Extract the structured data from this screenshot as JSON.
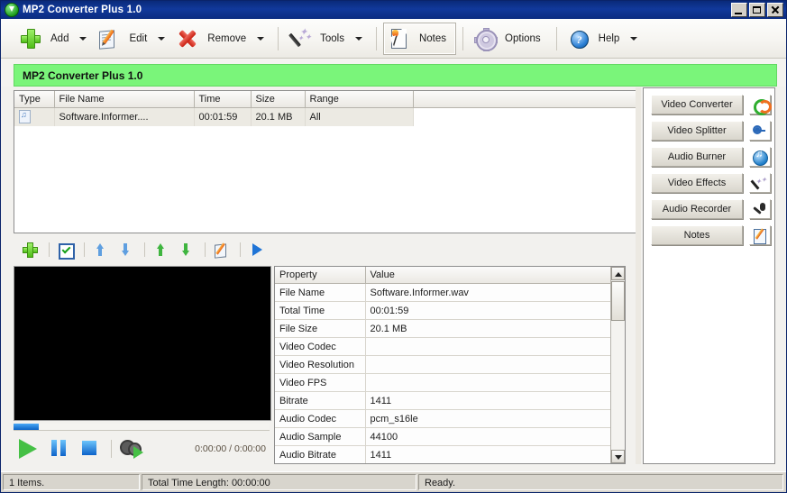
{
  "window": {
    "title": "MP2 Converter Plus 1.0",
    "icon": "download-arrow-icon",
    "controls": {
      "minimize": "Minimize",
      "maximize": "Maximize",
      "close": "Close"
    }
  },
  "toolbar": {
    "items": [
      {
        "label": "Add",
        "icon": "plus-icon",
        "caret": true,
        "pressed": false
      },
      {
        "label": "Edit",
        "icon": "edit-icon",
        "caret": true,
        "pressed": false
      },
      {
        "label": "Remove",
        "icon": "delete-icon",
        "caret": true,
        "pressed": false
      },
      {
        "label": "Tools",
        "icon": "wand-icon",
        "caret": true,
        "pressed": false
      },
      {
        "label": "Notes",
        "icon": "notes-icon",
        "caret": false,
        "pressed": true
      },
      {
        "label": "Options",
        "icon": "gear-icon",
        "caret": false,
        "pressed": false
      },
      {
        "label": "Help",
        "icon": "help-icon",
        "caret": true,
        "pressed": false
      }
    ]
  },
  "banner": {
    "text": "MP2 Converter Plus 1.0",
    "color": "#7af57a"
  },
  "file_list": {
    "columns": [
      "Type",
      "File Name",
      "Time",
      "Size",
      "Range"
    ],
    "rows": [
      {
        "type_icon": "audio-file-icon",
        "file_name": "Software.Informer....",
        "time": "00:01:59",
        "size": "20.1 MB",
        "range": "All"
      }
    ]
  },
  "mini_toolbar": {
    "buttons": [
      {
        "name": "add-file-button",
        "icon": "plus-icon"
      },
      {
        "name": "check-all-button",
        "icon": "checkbox-icon"
      },
      {
        "name": "move-up-button",
        "icon": "arrow-up-blue-icon"
      },
      {
        "name": "move-down-button",
        "icon": "arrow-down-blue-icon"
      },
      {
        "name": "move-top-button",
        "icon": "arrow-up-green-icon"
      },
      {
        "name": "move-bottom-button",
        "icon": "arrow-down-green-icon"
      },
      {
        "name": "edit-item-button",
        "icon": "edit-icon"
      },
      {
        "name": "start-button",
        "icon": "play-blue-icon"
      }
    ]
  },
  "preview": {
    "seek_percent": 10,
    "time_display": "0:00:00 / 0:00:00",
    "controls": [
      {
        "name": "play-button",
        "icon": "play-icon"
      },
      {
        "name": "pause-button",
        "icon": "pause-icon"
      },
      {
        "name": "stop-button",
        "icon": "stop-icon"
      },
      {
        "name": "snapshot-button",
        "icon": "film-play-icon"
      }
    ]
  },
  "properties": {
    "columns": [
      "Property",
      "Value"
    ],
    "rows": [
      {
        "property": "File Name",
        "value": "Software.Informer.wav"
      },
      {
        "property": "Total Time",
        "value": "00:01:59"
      },
      {
        "property": "File Size",
        "value": "20.1 MB"
      },
      {
        "property": "Video Codec",
        "value": ""
      },
      {
        "property": "Video Resolution",
        "value": ""
      },
      {
        "property": "Video FPS",
        "value": ""
      },
      {
        "property": "Bitrate",
        "value": "1411"
      },
      {
        "property": "Audio Codec",
        "value": "pcm_s16le"
      },
      {
        "property": "Audio Sample",
        "value": "44100"
      },
      {
        "property": "Audio Bitrate",
        "value": "1411"
      }
    ]
  },
  "right_panel": {
    "buttons": [
      {
        "label": "Video Converter",
        "icon": "convert-icon"
      },
      {
        "label": "Video Splitter",
        "icon": "scissors-icon"
      },
      {
        "label": "Audio Burner",
        "icon": "disc-music-icon"
      },
      {
        "label": "Video Effects",
        "icon": "magic-wand-icon"
      },
      {
        "label": "Audio Recorder",
        "icon": "microphone-icon"
      },
      {
        "label": "Notes",
        "icon": "notepad-pencil-icon"
      }
    ]
  },
  "status_bar": {
    "items_count": "1 Items.",
    "total_time": "Total Time Length: 00:00:00",
    "state": "Ready."
  }
}
